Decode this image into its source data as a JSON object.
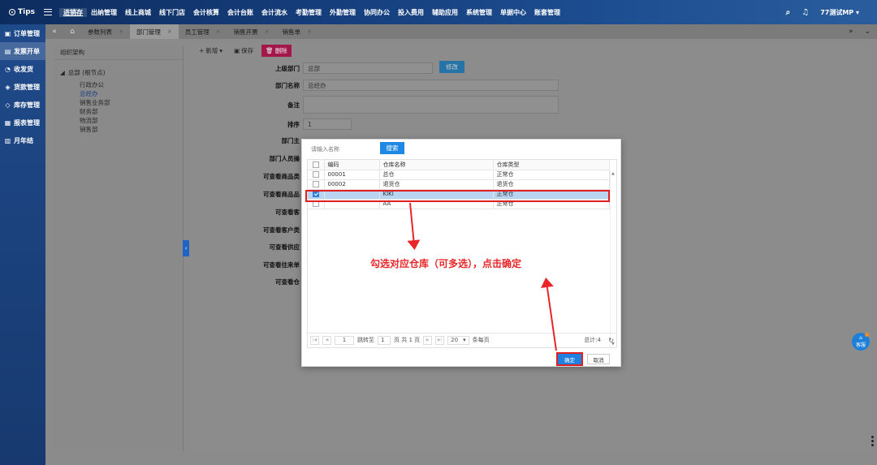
{
  "topbar": {
    "tips": "Tips",
    "nav": [
      "进销存",
      "出纳管理",
      "线上商城",
      "线下门店",
      "会计核算",
      "会计台账",
      "会计流水",
      "考勤管理",
      "外勤管理",
      "协同办公",
      "投入费用",
      "辅助应用",
      "系统管理",
      "单据中心",
      "账套管理"
    ],
    "active_nav": "进销存",
    "user": "77测试MP"
  },
  "sidebar": {
    "items": [
      {
        "label": "订单管理",
        "icon": "order-icon"
      },
      {
        "label": "发票开单",
        "icon": "invoice-icon"
      },
      {
        "label": "收发货",
        "icon": "delivery-icon"
      },
      {
        "label": "货款管理",
        "icon": "payment-icon"
      },
      {
        "label": "库存管理",
        "icon": "inventory-icon"
      },
      {
        "label": "报表管理",
        "icon": "report-icon"
      },
      {
        "label": "月年结",
        "icon": "calendar-icon"
      }
    ],
    "active": "发票开单"
  },
  "tabs": {
    "items": [
      "参数列表",
      "部门管理",
      "员工管理",
      "销售开票",
      "销售单"
    ],
    "active": "部门管理"
  },
  "left_panel": {
    "title": "组织架构",
    "root": "总部 (根节点)",
    "children": [
      "行政办公",
      "总经办",
      "销售业务部",
      "财务部",
      "物流部",
      "销售部"
    ],
    "selected": "总经办"
  },
  "toolbar": {
    "add": "新增",
    "save": "保存",
    "delete": "删除"
  },
  "form": {
    "parent_label": "上级部门",
    "parent_value": "总部",
    "modify": "修改",
    "name_label": "部门名称",
    "name_value": "总经办",
    "remark_label": "备注",
    "sort_label": "排序",
    "sort_value": "1",
    "manager_label": "部门主",
    "staff_label": "部门人员操",
    "goods_cat_label": "可查看商品类",
    "goods_brand_label": "可查看商品品",
    "customer_label": "可查看客",
    "customer_cat_label": "可查看客户类",
    "supplier_label": "可查看供应",
    "partner_label": "可查看往来单",
    "warehouse_label": "可查看仓"
  },
  "modal": {
    "search_placeholder": "请输入名称",
    "search_btn": "搜索",
    "headers": [
      "编码",
      "仓库名称",
      "仓库类型"
    ],
    "rows": [
      {
        "code": "00001",
        "name": "总仓",
        "type": "正常仓",
        "checked": false
      },
      {
        "code": "00002",
        "name": "退货仓",
        "type": "退货仓",
        "checked": false
      },
      {
        "code": "",
        "name": "KIKI",
        "type": "正常仓",
        "checked": true
      },
      {
        "code": "",
        "name": "AA",
        "type": "正常仓",
        "checked": false
      }
    ],
    "pager": {
      "page": "1",
      "jump_label": "跳转至",
      "jump_value": "1",
      "page_info": "页 共 1 页",
      "per_page": "20",
      "per_page_label": "条每页",
      "total": "总计:4"
    },
    "ok": "确定",
    "cancel": "取消"
  },
  "annotation": "勾选对应仓库（可多选），点击确定",
  "help": "客服",
  "colors": {
    "topbar": "#163f7e",
    "accent": "#1e88e5",
    "annotation": "#e8262a",
    "delete": "#a3174a"
  }
}
